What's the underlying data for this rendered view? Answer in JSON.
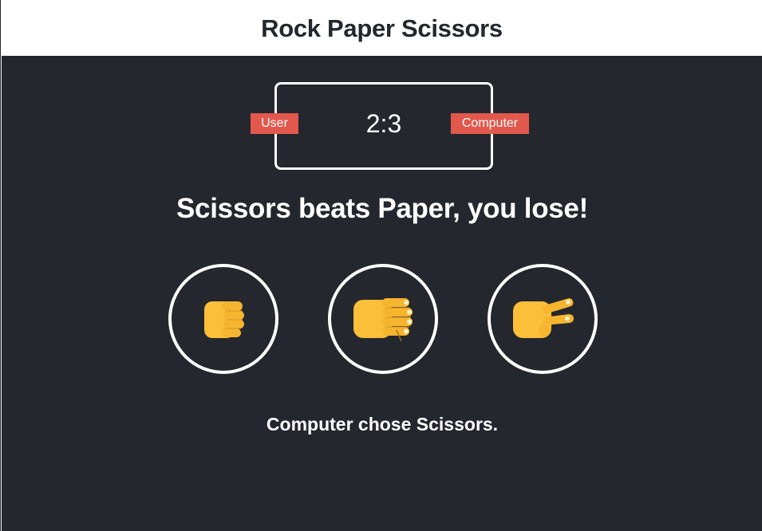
{
  "header": {
    "title": "Rock Paper Scissors"
  },
  "scoreboard": {
    "user_label": "User",
    "computer_label": "Computer",
    "score": "2:3"
  },
  "result": {
    "message": "Scissors beats Paper, you lose!"
  },
  "choices": [
    {
      "label": "Rock",
      "icon": "rock-hand-icon"
    },
    {
      "label": "Paper",
      "icon": "paper-hand-icon"
    },
    {
      "label": "Scissors",
      "icon": "scissors-hand-icon"
    }
  ],
  "action_message": "Computer chose Scissors.",
  "colors": {
    "header_bg": "#ffffff",
    "header_text": "#24272e",
    "main_bg": "#24272e",
    "badge_bg": "#e2584d",
    "text": "#ffffff",
    "hand": "#fbbf3a"
  }
}
